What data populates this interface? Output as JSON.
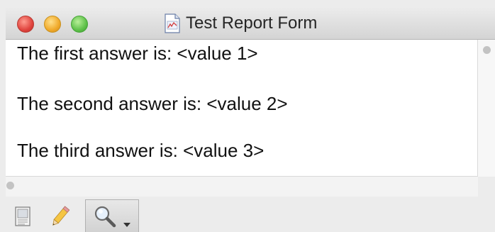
{
  "window": {
    "title": "Test Report Form",
    "title_icon": "report-document-icon",
    "traffic_lights": [
      "close",
      "minimize",
      "zoom"
    ]
  },
  "report": {
    "lines": [
      "The first answer is: <value 1>",
      "The second answer is: <value 2>",
      "The third answer is: <value 3>"
    ]
  },
  "toolbar": {
    "tools": [
      {
        "icon": "view-mode-icon"
      },
      {
        "icon": "pencil-icon"
      },
      {
        "icon": "magnifier-icon",
        "has_dropdown": true,
        "selected": true
      }
    ]
  },
  "colors": {
    "close": "#e0443e",
    "minimize": "#f0a92a",
    "zoom": "#5fc14a",
    "content_bg": "#ffffff",
    "chrome_bg": "#ececec"
  }
}
